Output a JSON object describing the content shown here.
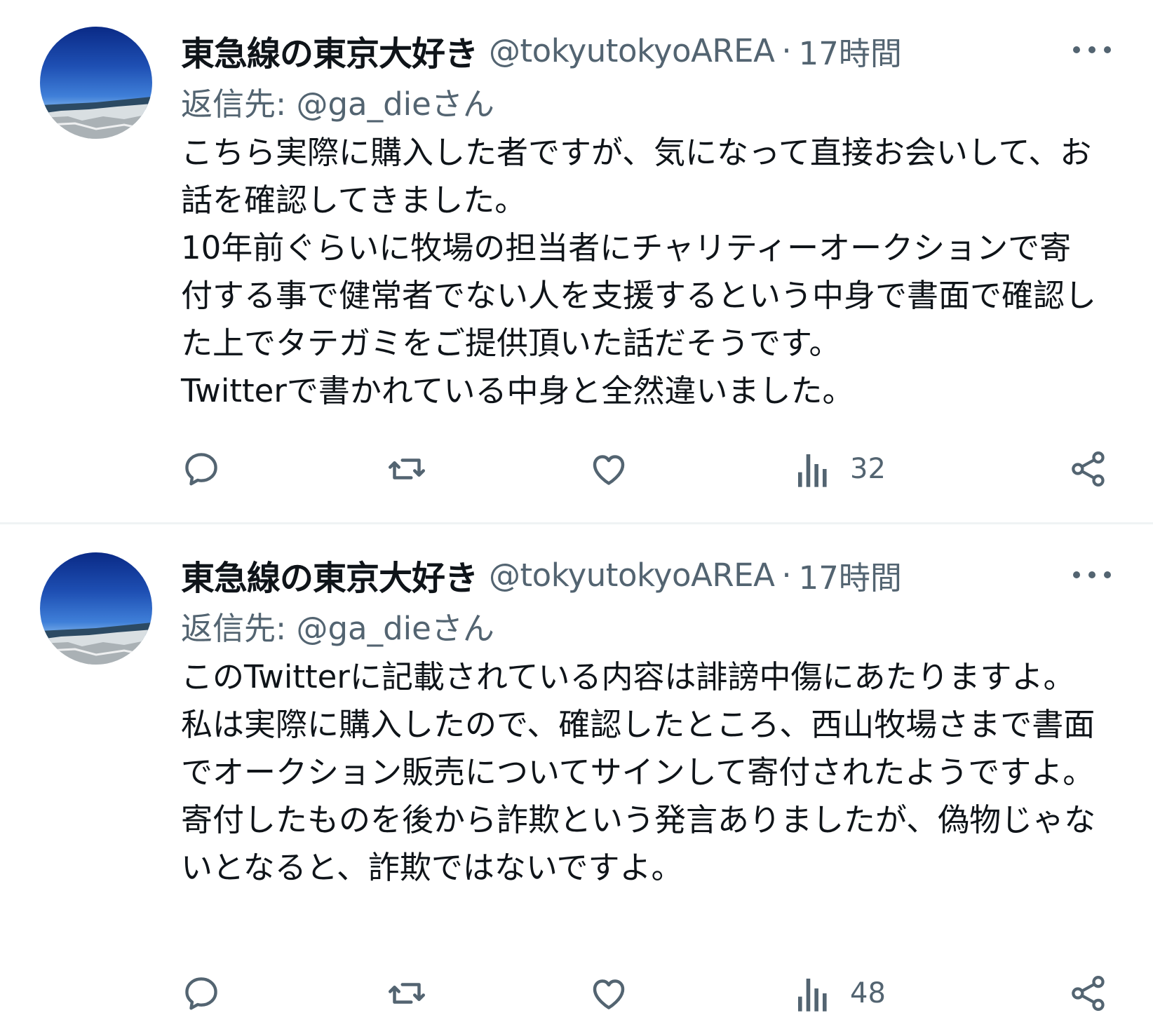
{
  "tweets": [
    {
      "display_name": "東急線の東京大好き",
      "handle": "@tokyutokyoAREA",
      "separator": "·",
      "time": "17時間",
      "reply_label": "返信先: ",
      "reply_mention": "@ga_dieさん",
      "body": "こちら実際に購入した者ですが、気になって直接お会いして、お話を確認してきました。\n10年前ぐらいに牧場の担当者にチャリティーオークションで寄付する事で健常者でない人を支援するという中身で書面で確認した上でタテガミをご提供頂いた話だそうです。\nTwitterで書かれている中身と全然違いました。",
      "actions": {
        "reply_icon": "reply-icon",
        "retweet_icon": "retweet-icon",
        "like_icon": "like-icon",
        "views_icon": "views-icon",
        "views_count": "32",
        "share_icon": "share-icon"
      }
    },
    {
      "display_name": "東急線の東京大好き",
      "handle": "@tokyutokyoAREA",
      "separator": "·",
      "time": "17時間",
      "reply_label": "返信先: ",
      "reply_mention": "@ga_dieさん",
      "body": "このTwitterに記載されている内容は誹謗中傷にあたりますよ。私は実際に購入したので、確認したところ、西山牧場さまで書面でオークション販売についてサインして寄付されたようですよ。\n寄付したものを後から詐欺という発言ありましたが、偽物じゃないとなると、詐欺ではないですよ。",
      "actions": {
        "reply_icon": "reply-icon",
        "retweet_icon": "retweet-icon",
        "like_icon": "like-icon",
        "views_icon": "views-icon",
        "views_count": "48",
        "share_icon": "share-icon"
      }
    }
  ],
  "colors": {
    "text_primary": "#0f1419",
    "text_secondary": "#536471",
    "divider": "#eff3f4",
    "background": "#ffffff"
  }
}
